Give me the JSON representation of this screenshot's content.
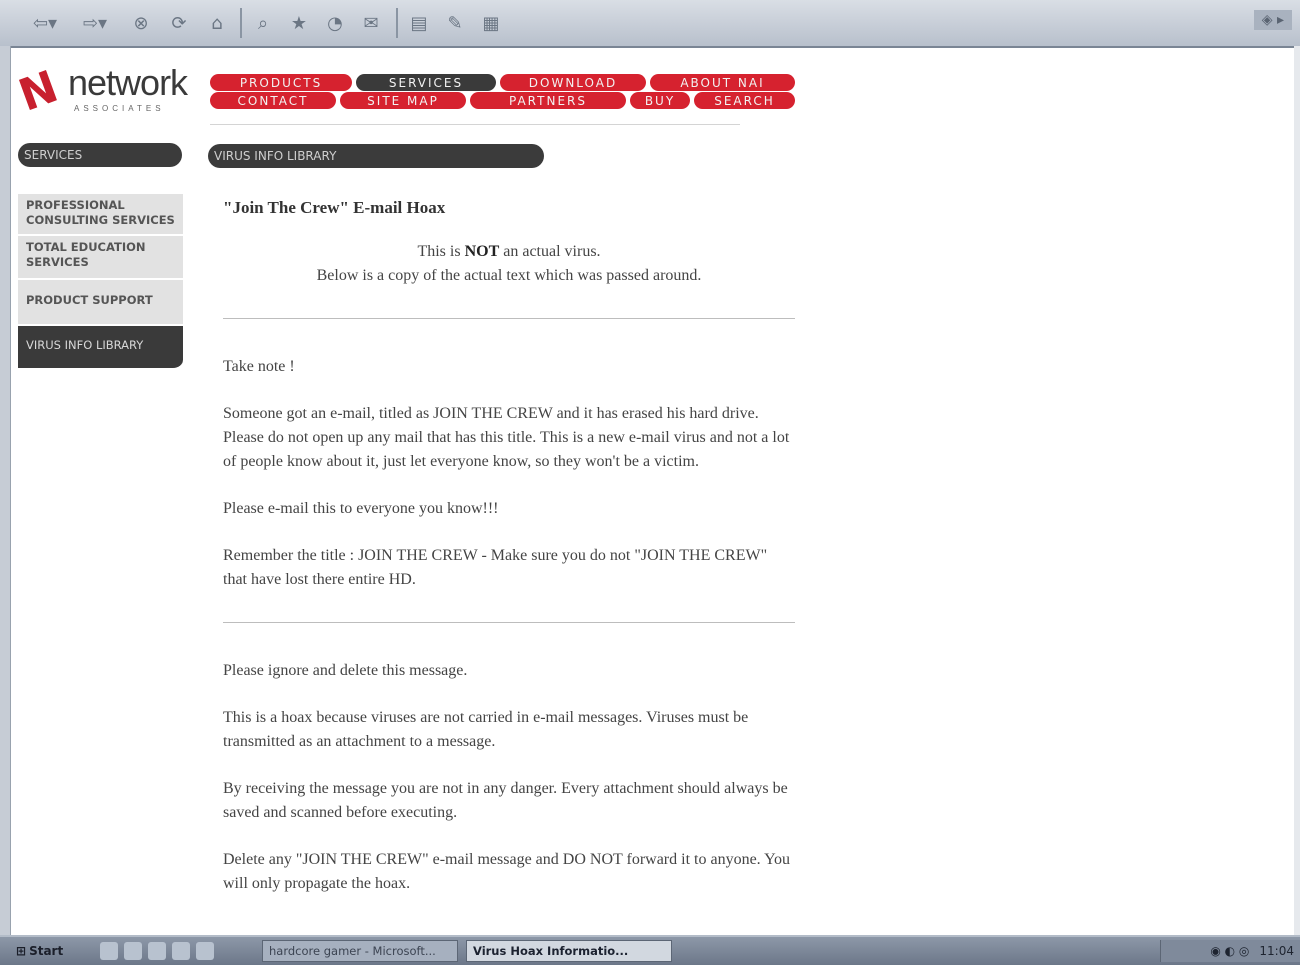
{
  "browser": {
    "toolbar_icons": [
      "back-arrow-icon",
      "forward-arrow-icon",
      "stop-icon",
      "refresh-icon",
      "home-icon",
      "search-icon",
      "favorites-icon",
      "history-icon",
      "mail-icon",
      "print-icon",
      "edit-icon",
      "discuss-icon"
    ]
  },
  "site": {
    "logo_word": "network",
    "logo_sub": "ASSOCIATES",
    "nav": {
      "products": "PRODUCTS",
      "services": "SERVICES",
      "download": "DOWNLOAD",
      "about": "ABOUT NAI",
      "contact": "CONTACT",
      "sitemap": "SITE MAP",
      "partners": "PARTNERS",
      "buy": "BUY",
      "search": "SEARCH"
    }
  },
  "sidebar": {
    "header": "SERVICES",
    "items": [
      {
        "label": "PROFESSIONAL CONSULTING SERVICES"
      },
      {
        "label": "TOTAL EDUCATION SERVICES"
      },
      {
        "label": "PRODUCT SUPPORT"
      },
      {
        "label": "VIRUS INFO LIBRARY"
      }
    ]
  },
  "main": {
    "section_header": "VIRUS INFO LIBRARY",
    "title": "\"Join The Crew\" E-mail Hoax",
    "notice_pre": "This is ",
    "notice_bold": "NOT",
    "notice_post": " an actual virus.",
    "notice_line2": "Below is a copy of the actual text which was passed around.",
    "p1": "Take note !",
    "p2": "Someone got an e-mail, titled as JOIN THE CREW and it has erased his hard drive. Please do not open up any mail that has this title. This is a new e-mail virus and not a lot of people know about it, just let everyone know, so they won't be a victim.",
    "p3": "Please e-mail this to everyone you know!!!",
    "p4": "Remember the title : JOIN THE CREW - Make sure you do not \"JOIN THE CREW\" that have lost there entire HD.",
    "p5": "Please ignore and delete this message.",
    "p6": "This is a hoax because viruses are not carried in e-mail messages. Viruses must be transmitted as an attachment to a message.",
    "p7": "By receiving the message you are not in any danger. Every attachment should always be saved and scanned before executing.",
    "p8": "Delete any \"JOIN THE CREW\" e-mail message and DO NOT forward it to anyone. You will only propagate the hoax."
  },
  "taskbar": {
    "start": "Start",
    "task1": "hardcore gamer - Microsoft...",
    "task2": "Virus Hoax Informatio...",
    "clock": "11:04"
  }
}
